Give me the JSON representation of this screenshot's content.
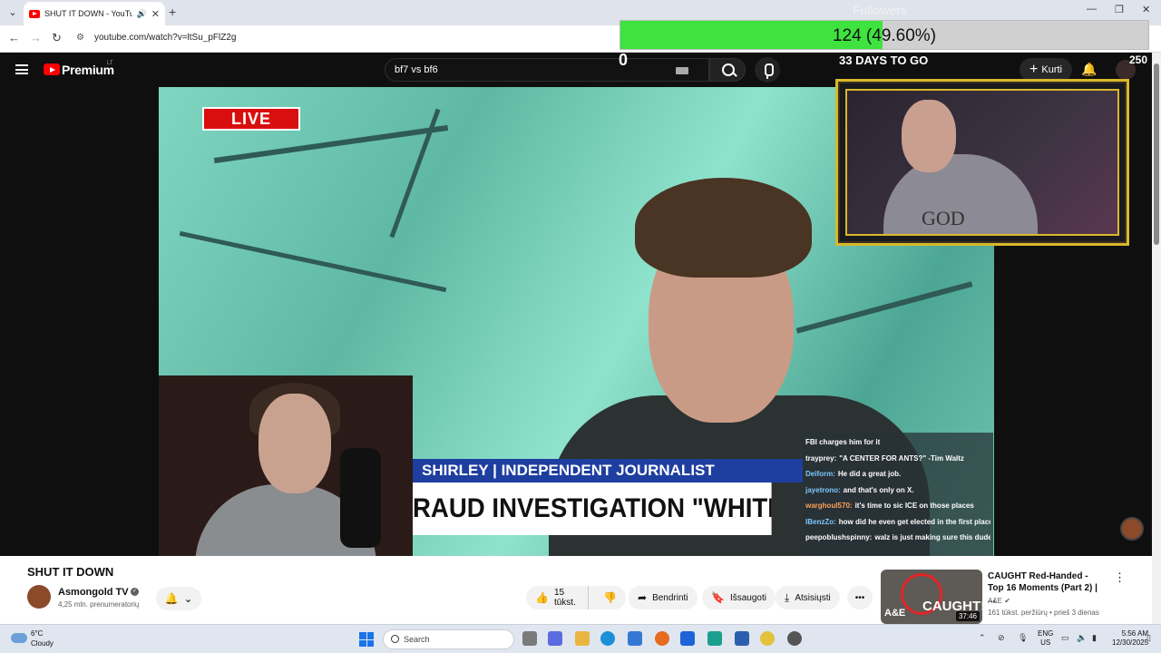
{
  "browser": {
    "tab_title": "SHUT IT DOWN - YouTube",
    "url": "youtube.com/watch?v=ltSu_pFlZ2g"
  },
  "youtube": {
    "logo_text": "Premium",
    "country_code": "LT",
    "search_query": "bf7 vs bf6",
    "create_label": "Kurti"
  },
  "overlay": {
    "followers_label": "Followers",
    "followers_progress_text": "124 (49.60%)",
    "followers_progress_fraction": 0.496,
    "followers_start": "0",
    "days_to_go": "33 DAYS TO GO",
    "goal_target": "250",
    "live_badge": "LIVE",
    "chyron_top": "SHIRLEY | INDEPENDENT JOURNALIST",
    "chyron_bottom": "RAUD INVESTIGATION \"WHITE SUPREMACY\"",
    "shirt_text": "GOD"
  },
  "chat": [
    {
      "user": "",
      "user_color": "#ffffff",
      "text": "FBI charges him for it"
    },
    {
      "user": "trayprey:",
      "user_color": "#ffffff",
      "text": "\"A CENTER FOR ANTS?\" -Tim Waltz"
    },
    {
      "user": "Deiform:",
      "user_color": "#7ec8ff",
      "text": "He did a great job."
    },
    {
      "user": "jayetrono:",
      "user_color": "#7ec8ff",
      "text": "and that's only on X."
    },
    {
      "user": "warghoul570:",
      "user_color": "#ff9f5a",
      "text": "it's time to sic ICE on those places"
    },
    {
      "user": "IBenzZo:",
      "user_color": "#7ec8ff",
      "text": "how did he even get elected in the first place?"
    },
    {
      "user": "peepoblushspinny:",
      "user_color": "#ffffff",
      "text": "walz is just making sure this dude has it as easy as possible with his blatant bullshit"
    }
  ],
  "video": {
    "title": "SHUT IT DOWN",
    "channel_name": "Asmongold TV",
    "subscribers": "4,25 mln. prenumeratorių",
    "like_count": "15 tūkst.",
    "share_label": "Bendrinti",
    "save_label": "Išsaugoti",
    "download_label": "Atsisiųsti"
  },
  "recommended": {
    "title": "CAUGHT Red-Handed - Top 16 Moments (Part 2) | ...",
    "channel": "A&E",
    "meta": "161 tūkst. peržiūrų • prieš 3 dienas",
    "duration": "37:46",
    "thumb_text": "CAUGHT!",
    "thumb_logo": "A&E"
  },
  "taskbar": {
    "temp": "6°C",
    "weather": "Cloudy",
    "search_placeholder": "Search",
    "lang_top": "ENG",
    "lang_bottom": "US",
    "time": "5:56 AM",
    "date": "12/30/2025"
  },
  "colors": {
    "yt_red": "#ff0000",
    "followers_fill": "#3fe33f",
    "webcam_frame": "#d8b82b",
    "live_red": "#d90f0f",
    "chyron_blue": "#1e3ea0"
  }
}
